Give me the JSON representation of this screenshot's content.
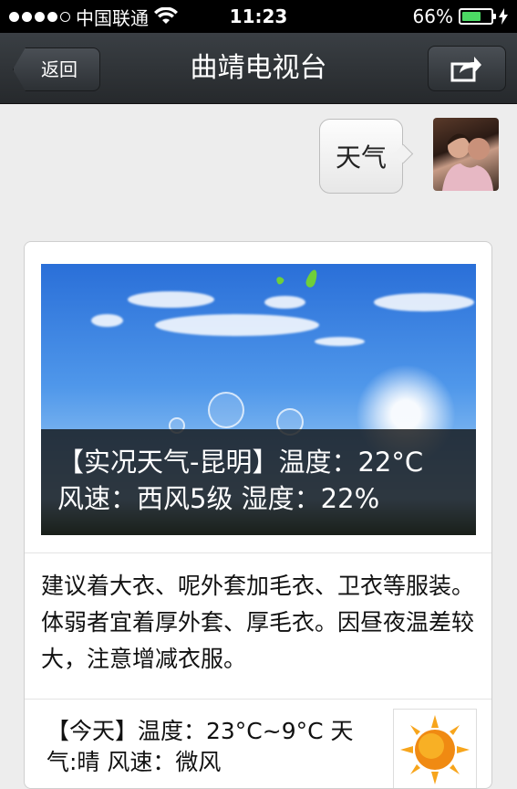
{
  "status_bar": {
    "carrier": "中国联通",
    "time": "11:23",
    "battery_percent": "66%",
    "battery_level": 0.66,
    "signal_bars_filled": 4,
    "signal_bars_total": 5
  },
  "nav": {
    "back_label": "返回",
    "title": "曲靖电视台",
    "share_icon": "share-icon"
  },
  "chat": {
    "message": "天气",
    "avatar_icon": "user-avatar"
  },
  "card": {
    "hero_caption_line1": "【实况天气-昆明】温度：22°C",
    "hero_caption_line2": "风速：西风5级 湿度：22%",
    "advice": "建议着大衣、呢外套加毛衣、卫衣等服装。体弱者宜着厚外套、厚毛衣。因昼夜温差较大，注意增减衣服。",
    "today_text": "【今天】温度：23°C~9°C 天气:晴 风速：微风",
    "today_icon": "sunny-icon"
  },
  "colors": {
    "nav_bg": "#2d3135",
    "battery_fill": "#4cd964",
    "sky": "#4f97ea"
  }
}
